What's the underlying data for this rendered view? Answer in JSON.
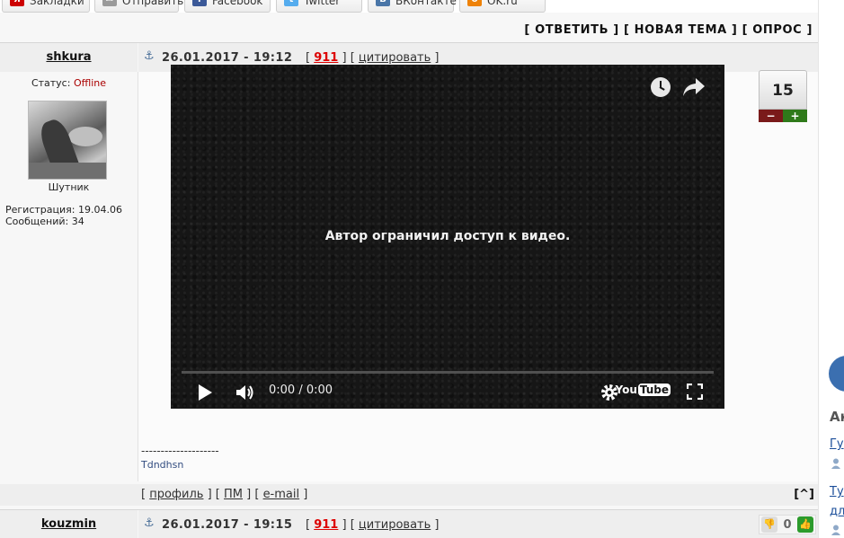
{
  "share": {
    "buttons": [
      {
        "label": "Закладки",
        "icon": "yandex-icon",
        "color": "#cc0000"
      },
      {
        "label": "Отправить",
        "icon": "mail-icon",
        "color": "#888888"
      },
      {
        "label": "Facebook",
        "icon": "facebook-icon",
        "color": "#3b5998"
      },
      {
        "label": "Twitter",
        "icon": "twitter-icon",
        "color": "#55acee"
      },
      {
        "label": "ВКонтакте",
        "icon": "vk-icon",
        "color": "#4a76a8"
      },
      {
        "label": "OK.ru",
        "icon": "ok-icon",
        "color": "#ee8208"
      }
    ]
  },
  "actions": {
    "reply": "[ ОТВЕТИТЬ ]",
    "new_topic": "[ НОВАЯ ТЕМА ]",
    "poll": "[ ОПРОС ]"
  },
  "post1": {
    "author": "shkura",
    "date": "26.01.2017 - 19:12",
    "post_number": "911",
    "quote_label": "цитировать",
    "status_label": "Статус:",
    "status_value": "Offline",
    "rank": "Шутник",
    "registration": "Регистрация: 19.04.06",
    "messages": "Сообщений: 34",
    "video": {
      "message": "Автор ограничил доступ к видео.",
      "time": "0:00 / 0:00",
      "brand_you": "You",
      "brand_tube": "Tube"
    },
    "rating": "15",
    "vote_minus": "−",
    "vote_plus": "+",
    "signature_line": "--------------------",
    "signature_name": "Tdndhsn",
    "footer": {
      "profile": "профиль",
      "pm": "ПМ",
      "email": "e-mail",
      "top": "[^]"
    }
  },
  "post2": {
    "author": "kouzmin",
    "date": "26.01.2017 - 19:15",
    "post_number": "911",
    "quote_label": "цитировать",
    "likes": "0"
  },
  "side": {
    "heading": "Ак",
    "link1": "Гу",
    "link2": "Ту",
    "link3": "дл"
  }
}
